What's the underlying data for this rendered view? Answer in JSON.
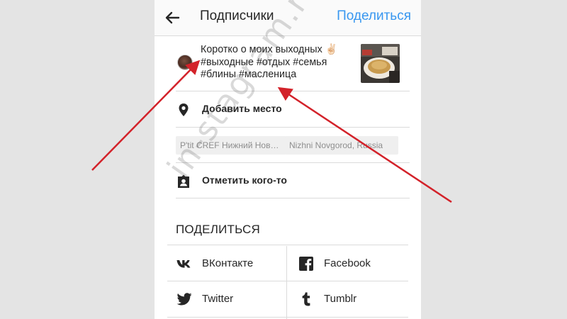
{
  "header": {
    "title": "Подписчики",
    "share_label": "Поделиться",
    "back_icon": "arrow-left-icon"
  },
  "post": {
    "caption": "Коротко о моих выходных ✌🏻\n#выходные #отдых #семья\n#блины #масленица"
  },
  "location": {
    "add_label": "Добавить место",
    "suggestions": [
      "P'tit CREF Нижний Нов…",
      "Nizhni Novgorod, Russia"
    ]
  },
  "tag_people": {
    "label": "Отметить кого-то"
  },
  "share_section": {
    "title": "ПОДЕЛИТЬСЯ",
    "services": [
      {
        "label": "ВКонтакте",
        "icon": "vk-icon"
      },
      {
        "label": "Facebook",
        "icon": "facebook-icon"
      },
      {
        "label": "Twitter",
        "icon": "twitter-icon"
      },
      {
        "label": "Tumblr",
        "icon": "tumblr-icon"
      }
    ]
  },
  "watermark": "in-stagram.ru",
  "colors": {
    "accent": "#3897f0",
    "annotation_arrow": "#d3222a",
    "background": "#e4e4e4"
  }
}
